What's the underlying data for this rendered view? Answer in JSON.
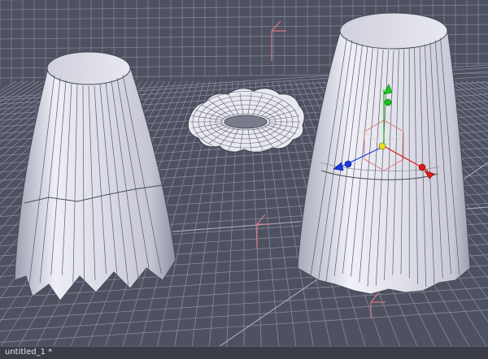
{
  "document": {
    "title": "untitled_1 *"
  },
  "viewport": {
    "view": "perspective",
    "background_color": "#4e5160",
    "grid_color": "#8a8ea0",
    "axis_color": "#d47a8a"
  },
  "scene": {
    "objects": [
      {
        "name": "fluted-column-left",
        "state": "unselected"
      },
      {
        "name": "ruffled-disc",
        "state": "unselected"
      },
      {
        "name": "fluted-column-right",
        "state": "selected"
      }
    ]
  },
  "gizmo": {
    "type": "transform",
    "x_color": "#e01818",
    "y_color": "#18b018",
    "z_color": "#1838e0",
    "center_color": "#e8e018"
  }
}
